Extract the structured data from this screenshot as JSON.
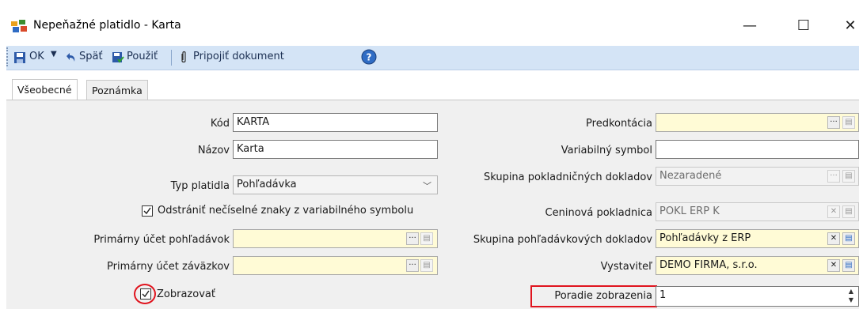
{
  "window": {
    "title": "Nepeňažné platidlo - Karta",
    "minimize": "—",
    "maximize": "☐",
    "close": "✕"
  },
  "toolbar": {
    "ok": "OK",
    "back": "Späť",
    "apply": "Použiť",
    "attach": "Pripojiť dokument"
  },
  "tabs": [
    {
      "label": "Všeobecné"
    },
    {
      "label": "Poznámka"
    }
  ],
  "left": {
    "kod_label": "Kód",
    "kod_value": "KARTA",
    "nazov_label": "Názov",
    "nazov_value": "Karta",
    "typ_label": "Typ platidla",
    "typ_value": "Pohľadávka",
    "remove_chars_label": "Odstrániť nečíselné znaky z variabilného symbolu",
    "primarny_pohl_label": "Primárny účet pohľadávok",
    "primarny_pohl_value": "",
    "primarny_zav_label": "Primárny účet záväzkov",
    "primarny_zav_value": "",
    "zobrazovat_label": "Zobrazovať"
  },
  "right": {
    "predkontacia_label": "Predkontácia",
    "predkontacia_value": "",
    "varsym_label": "Variabilný symbol",
    "varsym_value": "",
    "skupina_pokl_label": "Skupina pokladničných dokladov",
    "skupina_pokl_value": "Nezaradené",
    "ceninova_label": "Ceninová pokladnica",
    "ceninova_value": "POKL ERP K",
    "skupina_pohl_label": "Skupina pohľadávkových dokladov",
    "skupina_pohl_value": "Pohľadávky z ERP",
    "vystavitel_label": "Vystaviteľ",
    "vystavitel_value": "DEMO FIRMA, s.r.o.",
    "poradie_label": "Poradie zobrazenia",
    "poradie_value": "1"
  },
  "colors": {
    "toolbar_bg": "#d4e4f6",
    "highlight_red": "#e0141e",
    "yellow_field": "#fffbd6"
  }
}
